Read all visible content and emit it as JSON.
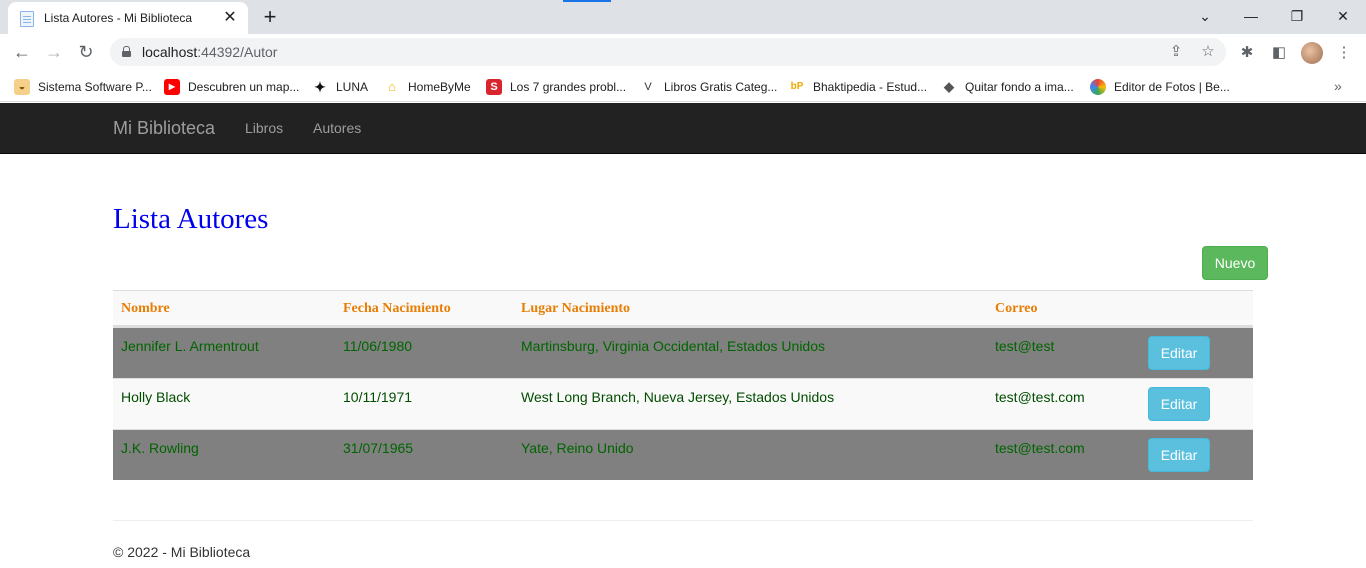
{
  "browser": {
    "tab_title": "Lista Autores - Mi Biblioteca",
    "url_host": "localhost",
    "url_rest": ":44392/Autor",
    "bookmarks": [
      {
        "label": "Sistema Software P...",
        "icon": "bowl-icon",
        "color": "#e8a33d"
      },
      {
        "label": "Descubren un map...",
        "icon": "youtube-icon",
        "color": "#ff0000"
      },
      {
        "label": "LUNA",
        "icon": "sparkle-icon",
        "color": "#111111"
      },
      {
        "label": "HomeByMe",
        "icon": "home-icon",
        "color": "#f2b600"
      },
      {
        "label": "Los 7 grandes probl...",
        "icon": "s-icon",
        "color": "#d9232d"
      },
      {
        "label": "Libros Gratis Categ...",
        "icon": "v-icon",
        "color": "#333333"
      },
      {
        "label": "Bhaktipedia - Estud...",
        "icon": "bp-icon",
        "color": "#f2a900"
      },
      {
        "label": "Quitar fondo a ima...",
        "icon": "layers-icon",
        "color": "#555555"
      },
      {
        "label": "Editor de Fotos | Be...",
        "icon": "circle-icon",
        "color": "#4285f4"
      }
    ]
  },
  "navbar": {
    "brand": "Mi Biblioteca",
    "links": [
      "Libros",
      "Autores"
    ]
  },
  "main": {
    "title": "Lista Autores",
    "new_button": "Nuevo",
    "columns": [
      "Nombre",
      "Fecha Nacimiento",
      "Lugar Nacimiento",
      "Correo"
    ],
    "rows": [
      {
        "nombre": "Jennifer L. Armentrout",
        "fecha": "11/06/1980",
        "lugar": "Martinsburg, Virginia Occidental, Estados Unidos",
        "correo": "test@test",
        "action": "Editar"
      },
      {
        "nombre": "Holly Black",
        "fecha": "10/11/1971",
        "lugar": "West Long Branch, Nueva Jersey, Estados Unidos",
        "correo": "test@test.com",
        "action": "Editar"
      },
      {
        "nombre": "J.K. Rowling",
        "fecha": "31/07/1965",
        "lugar": "Yate, Reino Unido",
        "correo": "test@test.com",
        "action": "Editar"
      }
    ]
  },
  "footer": {
    "text": "© 2022 - Mi Biblioteca"
  }
}
